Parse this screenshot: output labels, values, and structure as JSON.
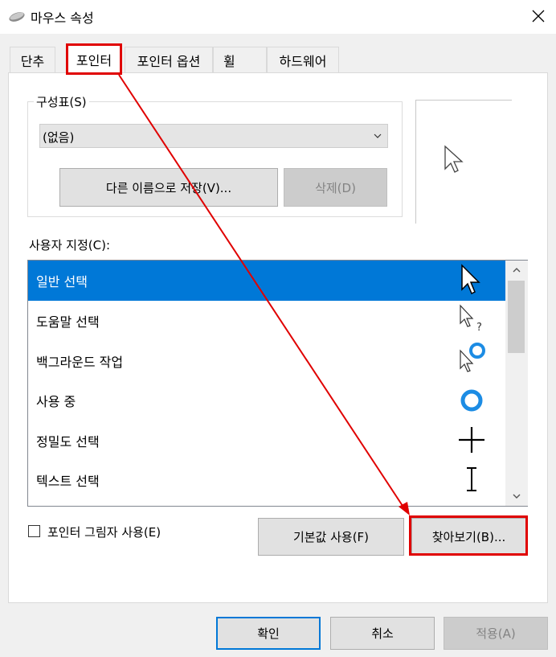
{
  "window": {
    "title": "마우스 속성",
    "icon": "mouse-icon",
    "close_icon": "close-icon"
  },
  "tabs": [
    {
      "label": "단추",
      "active": false
    },
    {
      "label": "포인터",
      "active": true
    },
    {
      "label": "포인터 옵션",
      "active": false
    },
    {
      "label": "휠",
      "active": false
    },
    {
      "label": "하드웨어",
      "active": false
    }
  ],
  "scheme": {
    "label": "구성표(S)",
    "selected": "(없음)",
    "save_as_label": "다른 이름으로 저장(V)...",
    "delete_label": "삭제(D)"
  },
  "customize": {
    "label": "사용자 지정(C):",
    "items": [
      {
        "label": "일반 선택",
        "icon": "arrow-pointer-icon",
        "selected": true
      },
      {
        "label": "도움말 선택",
        "icon": "help-pointer-icon",
        "selected": false
      },
      {
        "label": "백그라운드 작업",
        "icon": "working-in-background-icon",
        "selected": false
      },
      {
        "label": "사용 중",
        "icon": "busy-ring-icon",
        "selected": false
      },
      {
        "label": "정밀도 선택",
        "icon": "crosshair-icon",
        "selected": false
      },
      {
        "label": "텍스트 선택",
        "icon": "text-beam-icon",
        "selected": false
      }
    ]
  },
  "shadow": {
    "label": "포인터 그림자 사용(E)",
    "checked": false
  },
  "buttons": {
    "default_label": "기본값 사용(F)",
    "browse_label": "찾아보기(B)...",
    "ok_label": "확인",
    "cancel_label": "취소",
    "apply_label": "적용(A)"
  },
  "annotation": {
    "color": "#e00000"
  },
  "colors": {
    "accent": "#0078d7",
    "ok_border": "#0078d7"
  }
}
